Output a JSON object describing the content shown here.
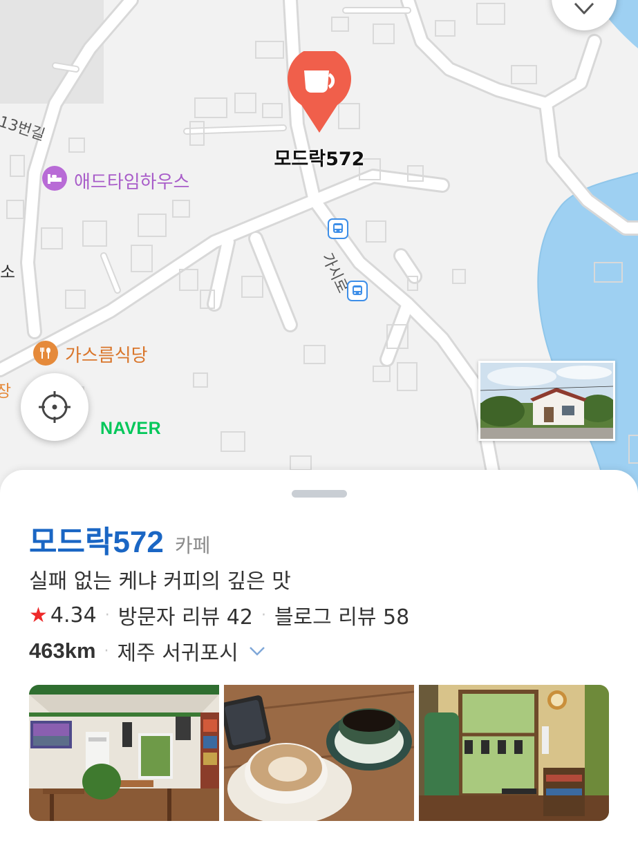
{
  "map": {
    "selected_place_label": "모드락572",
    "road_label": "13번길",
    "road_label_2": "가시로",
    "poi_lodging": "애드타임하우스",
    "poi_restaurant": "가스름식당",
    "edge_label_left": "소",
    "edge_label_left2": "장",
    "brand": "NAVER",
    "colors": {
      "pin": "#f05f4b",
      "lodging": "#b86bd6",
      "restaurant": "#e58a3b",
      "water": "#9ed0f2",
      "naver": "#03c75a"
    },
    "icons": [
      "coffee-cup-icon",
      "bed-icon",
      "fork-spoon-icon",
      "bus-icon",
      "crosshair-icon",
      "compass-arrow-icon"
    ]
  },
  "place": {
    "name": "모드락572",
    "category": "카페",
    "description": "실패 없는 케냐 커피의 깊은 맛",
    "rating": "4.34",
    "visitor_reviews": "방문자 리뷰 42",
    "blog_reviews": "블로그 리뷰 58",
    "distance": "463km",
    "address": "제주 서귀포시",
    "accent_color": "#1a66c4"
  },
  "photos": [
    {
      "alt": "interior-dining-room"
    },
    {
      "alt": "coffee-cups-on-table"
    },
    {
      "alt": "interior-window-bookshelf"
    }
  ]
}
